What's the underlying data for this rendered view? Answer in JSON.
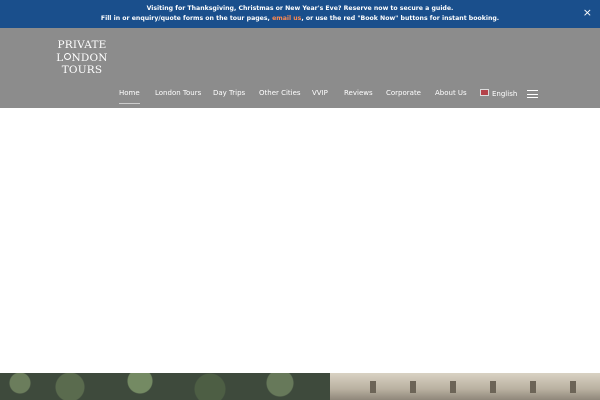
{
  "announcement": {
    "line1": "Visiting for Thanksgiving, Christmas or New Year's Eve? Reserve now to secure a guide.",
    "line2_before": "Fill in or enquiry/quote forms on the tour pages, ",
    "line2_link": "email us",
    "line2_after": ", or use the red \"Book Now\" buttons for instant booking.",
    "close_symbol": "×",
    "background_color": "#1a4f8c",
    "link_color": "#ff8a50"
  },
  "logo": {
    "line1": "PRIVATE",
    "line2_start": "L",
    "line2_end": "NDON",
    "line3": "TOURS"
  },
  "header": {
    "background_color": "#8c8c8c"
  },
  "nav": {
    "items": [
      {
        "label": "Home",
        "active": true
      },
      {
        "label": "London Tours"
      },
      {
        "label": "Day Trips"
      },
      {
        "label": "Other Cities"
      },
      {
        "label": "VVIP"
      },
      {
        "label": "Reviews"
      },
      {
        "label": "Corporate"
      },
      {
        "label": "About Us"
      },
      {
        "label": "English",
        "icon": "flag-icon"
      }
    ],
    "menu_icon": "hamburger-menu-icon"
  }
}
